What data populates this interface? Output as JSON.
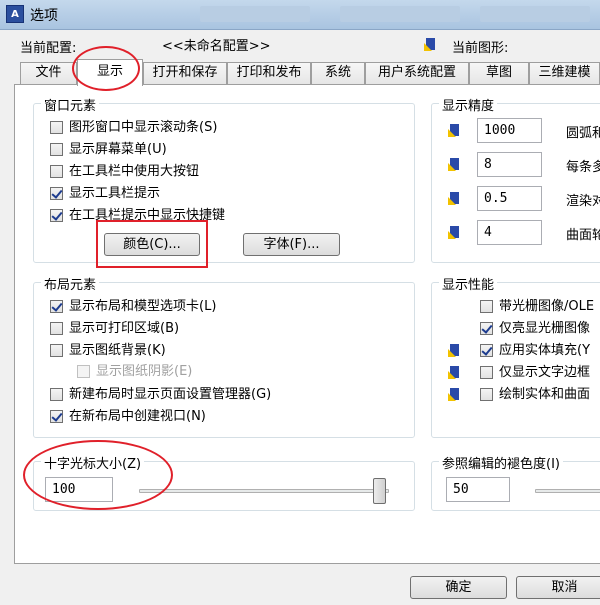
{
  "window": {
    "title": "选项",
    "app_icon_text": "A"
  },
  "profile": {
    "label": "当前配置:",
    "value": "<<未命名配置>>",
    "drawing_label": "当前图形:"
  },
  "tabs": [
    {
      "label": "文件"
    },
    {
      "label": "显示",
      "active": true
    },
    {
      "label": "打开和保存"
    },
    {
      "label": "打印和发布"
    },
    {
      "label": "系统"
    },
    {
      "label": "用户系统配置"
    },
    {
      "label": "草图"
    },
    {
      "label": "三维建模"
    }
  ],
  "window_elements": {
    "title": "窗口元素",
    "checkboxes": [
      {
        "label": "图形窗口中显示滚动条(S)",
        "checked": false
      },
      {
        "label": "显示屏幕菜单(U)",
        "checked": false
      },
      {
        "label": "在工具栏中使用大按钮",
        "checked": false
      },
      {
        "label": "显示工具栏提示",
        "checked": true
      },
      {
        "label": "在工具栏提示中显示快捷键",
        "checked": true
      }
    ],
    "color_button": "颜色(C)...",
    "font_button": "字体(F)..."
  },
  "layout_elements": {
    "title": "布局元素",
    "checkboxes": [
      {
        "label": "显示布局和模型选项卡(L)",
        "checked": true
      },
      {
        "label": "显示可打印区域(B)",
        "checked": false
      },
      {
        "label": "显示图纸背景(K)",
        "checked": false
      },
      {
        "label": "显示图纸阴影(E)",
        "checked": false,
        "disabled": true
      },
      {
        "label": "新建布局时显示页面设置管理器(G)",
        "checked": false
      },
      {
        "label": "在新布局中创建视口(N)",
        "checked": true
      }
    ]
  },
  "crosshair": {
    "title": "十字光标大小(Z)",
    "value": "100",
    "slider_percent": 100
  },
  "display_resolution": {
    "title": "显示精度",
    "rows": [
      {
        "value": "1000",
        "label": "圆弧和"
      },
      {
        "value": "8",
        "label": "每条多"
      },
      {
        "value": "0.5",
        "label": "渲染对"
      },
      {
        "value": "4",
        "label": "曲面轮"
      }
    ]
  },
  "display_performance": {
    "title": "显示性能",
    "checkboxes": [
      {
        "label": "带光栅图像/OLE",
        "checked": false,
        "has_icon": false
      },
      {
        "label": "仅亮显光栅图像",
        "checked": true,
        "has_icon": false
      },
      {
        "label": "应用实体填充(Y",
        "checked": true,
        "has_icon": true
      },
      {
        "label": "仅显示文字边框",
        "checked": false,
        "has_icon": true
      },
      {
        "label": "绘制实体和曲面",
        "checked": false,
        "has_icon": true
      }
    ]
  },
  "xref_fade": {
    "title": "参照编辑的褪色度(I)",
    "value": "50"
  },
  "buttons": {
    "ok": "确定",
    "cancel": "取消"
  },
  "colors": {
    "annotation_red": "#e0202a",
    "checkmark": "#1d3c8f",
    "titlebar": "#a9c4e0"
  }
}
